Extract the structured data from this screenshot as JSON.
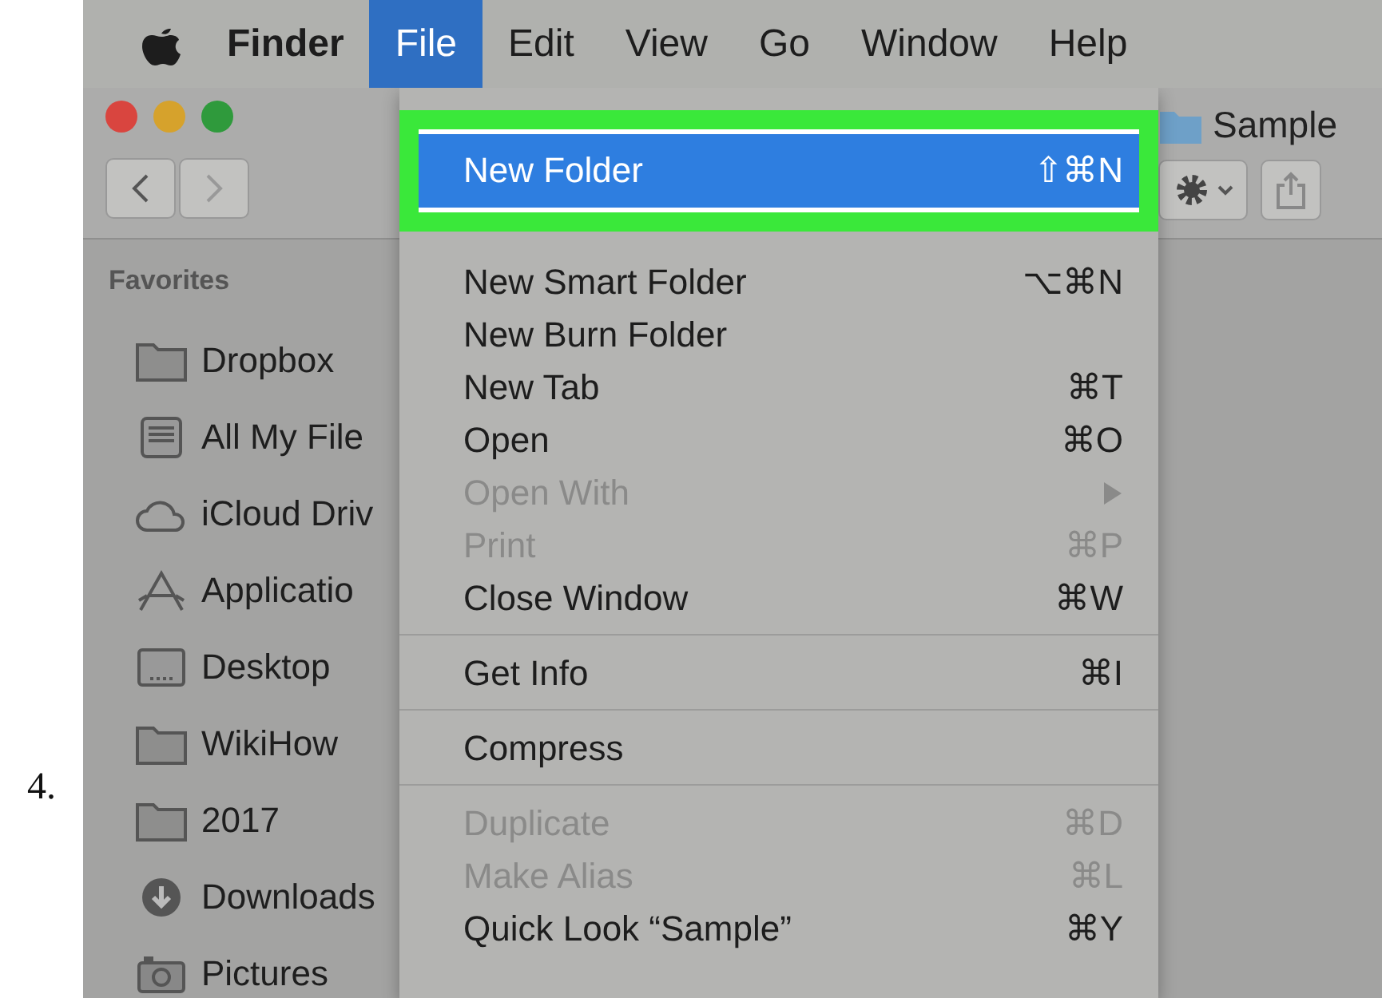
{
  "step_number": "4.",
  "menu_bar": {
    "items": [
      {
        "label": "Finder",
        "kind": "app",
        "selected": false
      },
      {
        "label": "File",
        "kind": "menu",
        "selected": true
      },
      {
        "label": "Edit",
        "kind": "menu",
        "selected": false
      },
      {
        "label": "View",
        "kind": "menu",
        "selected": false
      },
      {
        "label": "Go",
        "kind": "menu",
        "selected": false
      },
      {
        "label": "Window",
        "kind": "menu",
        "selected": false
      },
      {
        "label": "Help",
        "kind": "menu",
        "selected": false
      }
    ]
  },
  "window": {
    "title": "Sample"
  },
  "sidebar": {
    "heading": "Favorites",
    "items": [
      {
        "label": "Dropbox",
        "kind": "folder"
      },
      {
        "label": "All My File",
        "kind": "files"
      },
      {
        "label": "iCloud Driv",
        "kind": "cloud"
      },
      {
        "label": "Applicatio",
        "kind": "apps"
      },
      {
        "label": "Desktop",
        "kind": "desktop"
      },
      {
        "label": "WikiHow",
        "kind": "folder"
      },
      {
        "label": "2017",
        "kind": "folder"
      },
      {
        "label": "Downloads",
        "kind": "downloads"
      },
      {
        "label": "Pictures",
        "kind": "pictures"
      }
    ]
  },
  "file_menu": {
    "items": [
      {
        "kind": "item",
        "label": "New Folder",
        "shortcut": "⇧⌘N",
        "selected": true,
        "disabled": false
      },
      {
        "kind": "item",
        "label": "New Smart Folder",
        "shortcut": "⌥⌘N",
        "selected": false,
        "disabled": false
      },
      {
        "kind": "item",
        "label": "New Burn Folder",
        "selected": false,
        "disabled": false
      },
      {
        "kind": "item",
        "label": "New Tab",
        "shortcut": "⌘T",
        "selected": false,
        "disabled": false
      },
      {
        "kind": "item",
        "label": "Open",
        "shortcut": "⌘O",
        "selected": false,
        "disabled": false
      },
      {
        "kind": "submenu",
        "label": "Open With",
        "selected": false,
        "disabled": true
      },
      {
        "kind": "item",
        "label": "Print",
        "shortcut": "⌘P",
        "selected": false,
        "disabled": true
      },
      {
        "kind": "item",
        "label": "Close Window",
        "shortcut": "⌘W",
        "selected": false,
        "disabled": false
      },
      {
        "kind": "separator"
      },
      {
        "kind": "item",
        "label": "Get Info",
        "shortcut": "⌘I",
        "selected": false,
        "disabled": false
      },
      {
        "kind": "separator"
      },
      {
        "kind": "item",
        "label": "Compress",
        "selected": false,
        "disabled": false
      },
      {
        "kind": "separator"
      },
      {
        "kind": "item",
        "label": "Duplicate",
        "shortcut": "⌘D",
        "selected": false,
        "disabled": true
      },
      {
        "kind": "item",
        "label": "Make Alias",
        "shortcut": "⌘L",
        "selected": false,
        "disabled": true
      },
      {
        "kind": "item",
        "label": "Quick Look “Sample”",
        "shortcut": "⌘Y",
        "selected": false,
        "disabled": false
      }
    ]
  }
}
